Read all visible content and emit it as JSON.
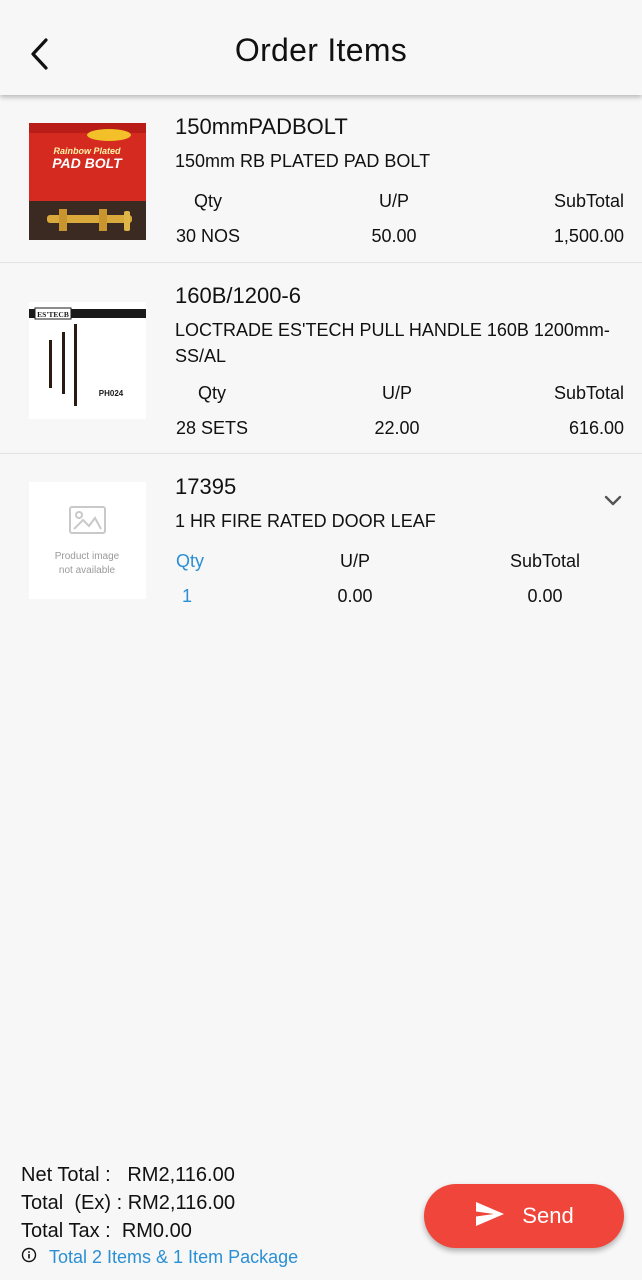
{
  "header": {
    "title": "Order Items"
  },
  "items": [
    {
      "code": "150mmPADBOLT",
      "description": "150mm RB PLATED PAD BOLT",
      "headers": {
        "qty": "Qty",
        "up": "U/P",
        "subtotal": "SubTotal"
      },
      "qty": "30 NOS",
      "up": "50.00",
      "subtotal": "1,500.00",
      "image": {
        "line1": "Rainbow Plated",
        "line2": "PAD BOLT"
      }
    },
    {
      "code": "160B/1200-6",
      "description": "LOCTRADE ES'TECH PULL HANDLE 160B 1200mm-SS/AL",
      "headers": {
        "qty": "Qty",
        "up": "U/P",
        "subtotal": "SubTotal"
      },
      "qty": "28 SETS",
      "up": "22.00",
      "subtotal": "616.00",
      "image": {
        "brand": "ES'TECB",
        "model": "PH024"
      }
    },
    {
      "code": "17395",
      "description": "1 HR FIRE RATED DOOR LEAF",
      "headers": {
        "qty": "Qty",
        "up": "U/P",
        "subtotal": "SubTotal"
      },
      "qty": "1",
      "up": "0.00",
      "subtotal": "0.00",
      "image": {
        "placeholder_line1": "Product image",
        "placeholder_line2": "not available"
      }
    }
  ],
  "footer": {
    "net_total_label": "Net Total :",
    "net_total_value": "RM2,116.00",
    "total_ex_label": "Total  (Ex) :",
    "total_ex_value": "RM2,116.00",
    "total_tax_label": "Total Tax :",
    "total_tax_value": "RM0.00",
    "info_text": "Total 2 Items & 1 Item Package",
    "send_label": "Send"
  },
  "colors": {
    "accent_blue": "#2a8fd4",
    "send_red": "#f0453a",
    "background": "#f7f7f7"
  }
}
